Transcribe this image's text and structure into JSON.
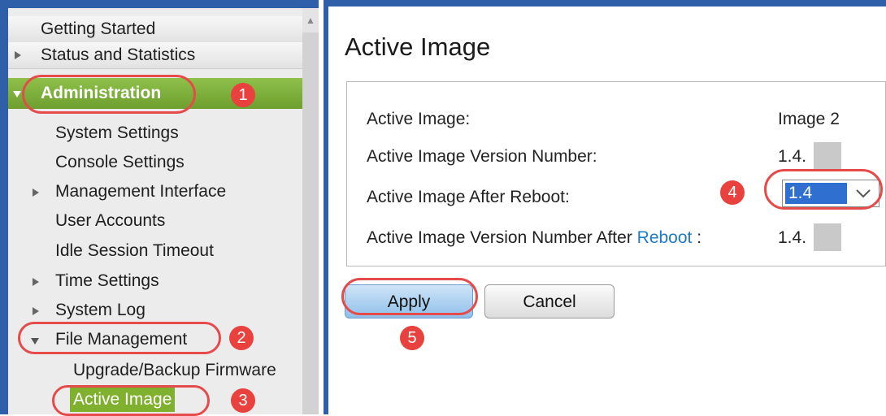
{
  "sidebar": {
    "items": [
      {
        "label": "Getting Started"
      },
      {
        "label": "Status and Statistics"
      },
      {
        "label": "Administration"
      },
      {
        "label": "System Settings"
      },
      {
        "label": "Console Settings"
      },
      {
        "label": "Management Interface"
      },
      {
        "label": "User Accounts"
      },
      {
        "label": "Idle Session Timeout"
      },
      {
        "label": "Time Settings"
      },
      {
        "label": "System Log"
      },
      {
        "label": "File Management"
      },
      {
        "label": "Upgrade/Backup Firmware"
      },
      {
        "label": "Active Image"
      }
    ]
  },
  "main": {
    "title": "Active Image",
    "rows": [
      {
        "label": "Active Image:",
        "value": "Image 2"
      },
      {
        "label": "Active Image Version Number:",
        "value": "1.4."
      },
      {
        "label": "Active Image After Reboot:",
        "value": "1.4"
      },
      {
        "label_prefix": "Active Image Version Number After ",
        "label_link": "Reboot",
        "label_suffix": " :",
        "value": "1.4."
      }
    ],
    "apply_label": "Apply",
    "cancel_label": "Cancel"
  },
  "annotations": {
    "badges": [
      "1",
      "2",
      "3",
      "4",
      "5"
    ],
    "color": "#e54b4b"
  },
  "colors": {
    "nav_blue": "#2f5fa8",
    "admin_green": "#7fb12e",
    "link_blue": "#1f7ac6"
  }
}
